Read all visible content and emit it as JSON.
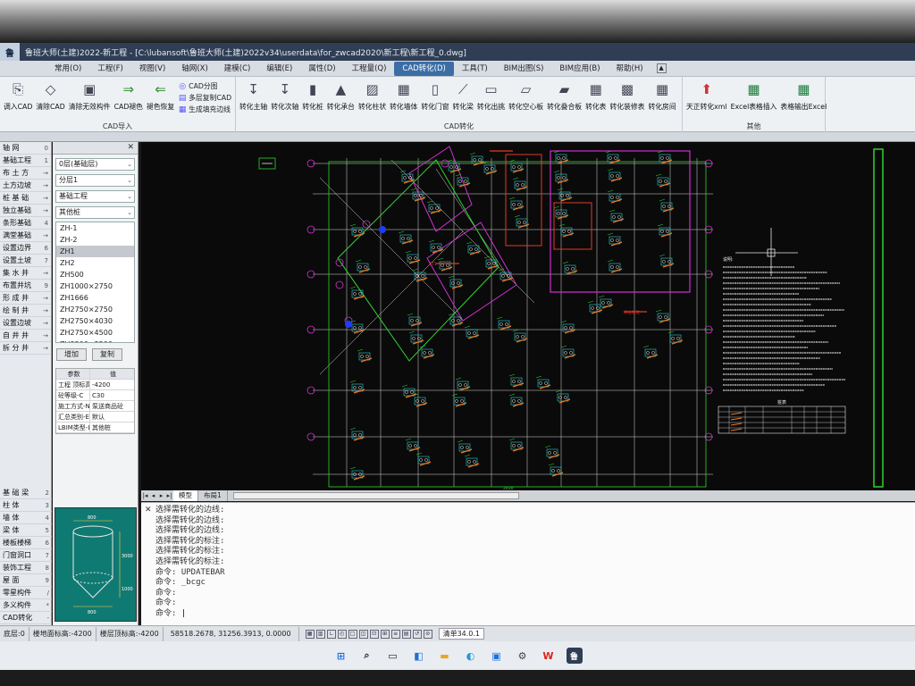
{
  "window": {
    "title": "鲁班大师(土建)2022-新工程 - [C:\\lubansoft\\鲁班大师(土建)2022v34\\userdata\\for_zwcad2020\\新工程\\新工程_0.dwg]"
  },
  "menu": [
    "常用(O)",
    "工程(F)",
    "视图(V)",
    "轴网(X)",
    "建模(C)",
    "编辑(E)",
    "属性(D)",
    "工程量(Q)",
    "CAD转化(D)",
    "工具(T)",
    "BIM出图(S)",
    "BIM应用(B)",
    "帮助(H)"
  ],
  "menu_active": "CAD转化(D)",
  "ribbon": {
    "g1": {
      "name": "CAD导入",
      "big": [
        "调入CAD",
        "清除CAD",
        "清除无效构件",
        "CAD褪色",
        "褪色恢复"
      ],
      "small": [
        "CAD分图",
        "多层复制CAD",
        "生成填充边线"
      ]
    },
    "g2": {
      "name": "CAD转化",
      "big": [
        "转化主轴",
        "转化次轴",
        "转化桩",
        "转化承台",
        "转化柱状",
        "转化墙体",
        "转化门窗",
        "转化梁",
        "转化出挑",
        "转化空心板",
        "转化叠合板",
        "转化表",
        "转化装修表",
        "转化房间"
      ]
    },
    "g3": {
      "name": "其他",
      "big": [
        "天正转化xml",
        "Excel表格插入",
        "表格输出Excel"
      ]
    }
  },
  "leftnav": {
    "top": [
      {
        "label": "轴 网",
        "sc": "0"
      },
      {
        "label": "基础工程",
        "sc": "1"
      },
      {
        "label": "布 土 方",
        "sc": "→"
      },
      {
        "label": "土方边坡",
        "sc": "→"
      },
      {
        "label": "桩 基 础",
        "sc": "→"
      },
      {
        "label": "独立基础",
        "sc": "→"
      },
      {
        "label": "条形基础",
        "sc": "4"
      },
      {
        "label": "满堂基础",
        "sc": "→"
      },
      {
        "label": "设置边界",
        "sc": "6"
      },
      {
        "label": "设置土坡",
        "sc": "7"
      },
      {
        "label": "集 水 井",
        "sc": "→"
      },
      {
        "label": "布置井坑",
        "sc": "9"
      },
      {
        "label": "形 成 井",
        "sc": "→"
      },
      {
        "label": "绘 制 井",
        "sc": "→"
      },
      {
        "label": "设置边坡",
        "sc": "→"
      },
      {
        "label": "自 井 井",
        "sc": "→"
      },
      {
        "label": "拆 分 井",
        "sc": "→"
      }
    ],
    "bottom": [
      {
        "label": "基 础 梁",
        "sc": "2"
      },
      {
        "label": "柱 体",
        "sc": "3"
      },
      {
        "label": "墙 体",
        "sc": "4"
      },
      {
        "label": "梁 体",
        "sc": "5"
      },
      {
        "label": "楼板楼梯",
        "sc": "6"
      },
      {
        "label": "门窗洞口",
        "sc": "7"
      },
      {
        "label": "装饰工程",
        "sc": "8"
      },
      {
        "label": "屋 面",
        "sc": "9"
      },
      {
        "label": "零星构件",
        "sc": "/"
      },
      {
        "label": "多义构件",
        "sc": "*"
      },
      {
        "label": "CAD转化",
        "sc": "-"
      }
    ]
  },
  "props": {
    "floor": "0层(基础层)",
    "sublayer": "分层1",
    "category": "基础工程",
    "type": "其他桩",
    "items": [
      "ZH-1",
      "ZH-2",
      "ZH1",
      "ZH2",
      "ZH500",
      "ZH1000×2750",
      "ZH1666",
      "ZH2750×2750",
      "ZH2750×4030",
      "ZH2750×4500",
      "ZH3500×3500"
    ],
    "selected": "ZH1",
    "btn_add": "增加",
    "btn_copy": "复制",
    "table_header": [
      "参数",
      "值"
    ],
    "table": [
      [
        "工程 顶标高",
        "-4200"
      ],
      [
        "砼等级-C",
        "C30"
      ],
      [
        "施工方式-N",
        "泵送商品砼"
      ],
      [
        "汇总类别-E",
        "默认"
      ],
      [
        "LBIM类型-L",
        "其他桩"
      ]
    ]
  },
  "preview": {
    "dim_top": "800",
    "dim_side1": "3000",
    "dim_side2": "1000",
    "dim_bot": "800"
  },
  "tabs": [
    "模型",
    "布局1"
  ],
  "canvas_text": {
    "notes_title": "说明:",
    "table_title": "桩表",
    "red_label": "CT1",
    "legend": "承台桩位",
    "bottom_dim": "2430"
  },
  "command": {
    "lines": [
      "选择需转化的边线:",
      "选择需转化的边线:",
      "选择需转化的边线:",
      "选择需转化的标注:",
      "选择需转化的标注:",
      "选择需转化的标注:",
      "命令: UPDATEBAR",
      "命令: _bcgc",
      "命令:",
      "命令:"
    ],
    "prompt": "命令:"
  },
  "status": {
    "layer": "底层:0",
    "floor_elev": "楼地面标高:-4200",
    "top_elev": "楼层顶标高:-4200",
    "coords": "58518.2678, 31256.3913, 0.0000",
    "version": "清单34.0.1"
  },
  "colors": {
    "accent": "#3b6ea5",
    "canvas": "#0a0a0a",
    "green": "#2fd22f",
    "magenta": "#d030d0",
    "orange": "#f07a1e",
    "cyan": "#2fd0d0",
    "red": "#e03a2a"
  }
}
